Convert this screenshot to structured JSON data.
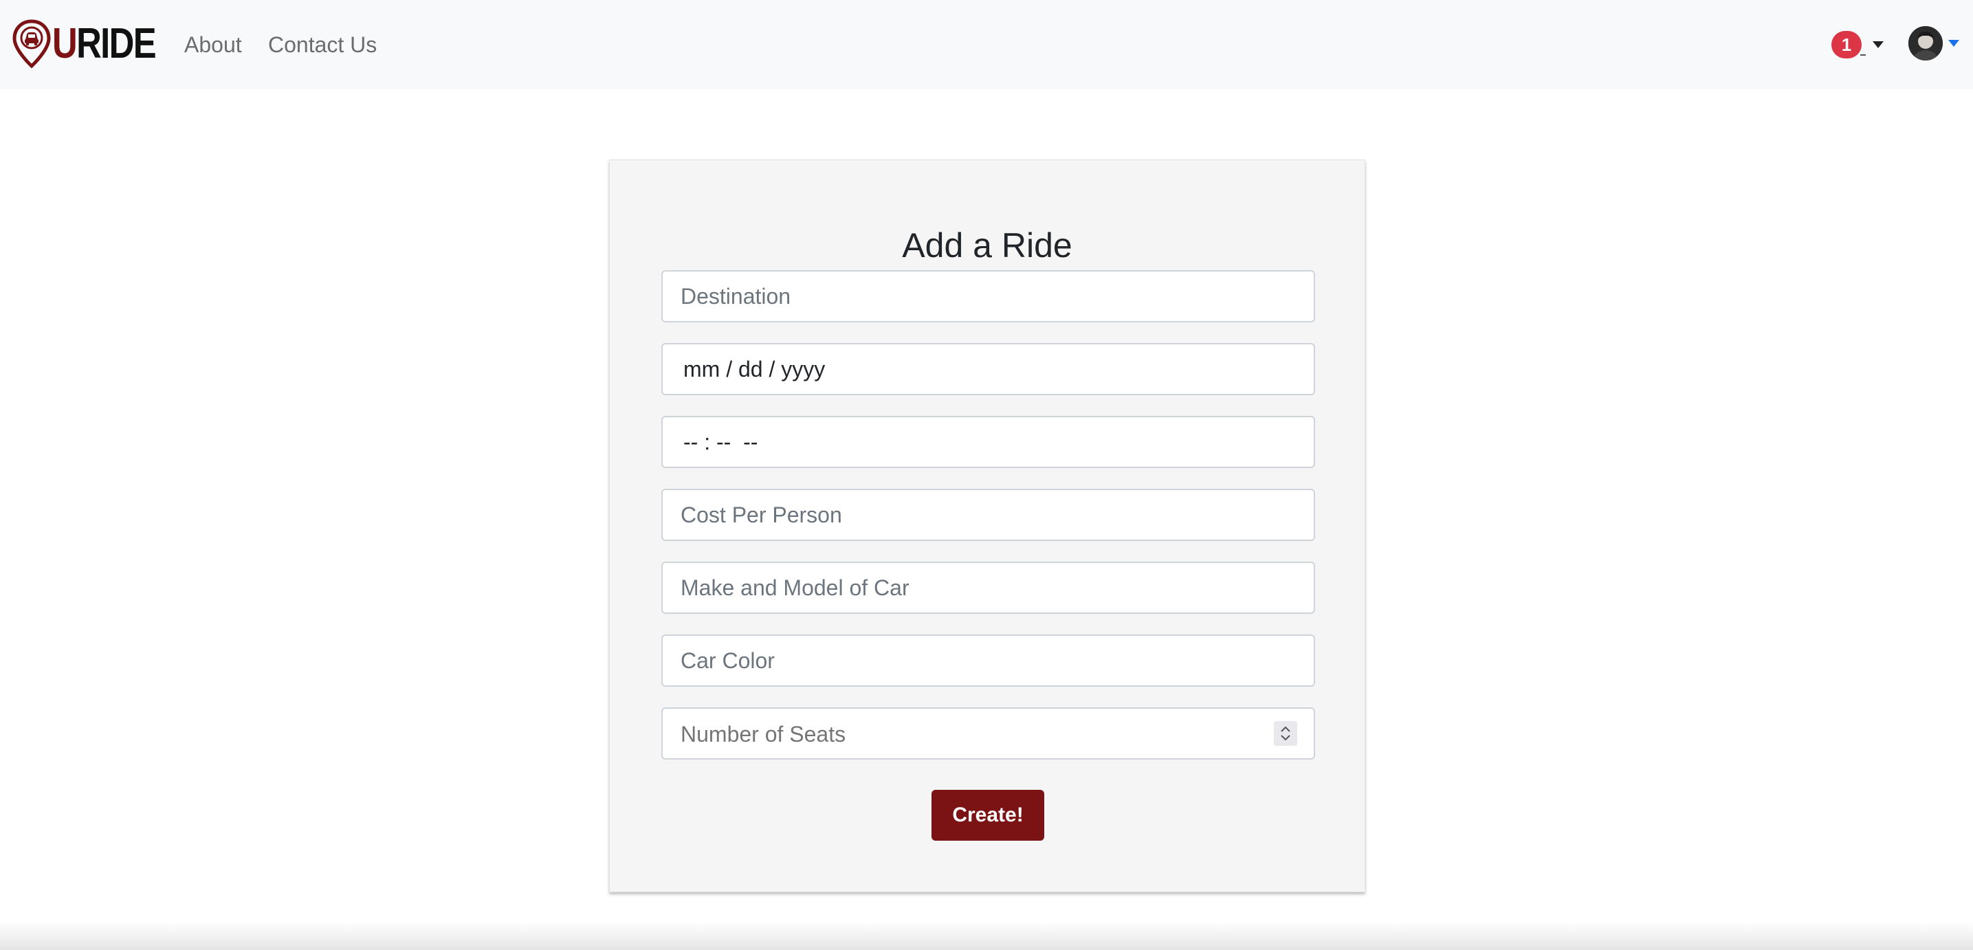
{
  "brand": {
    "name": "URIDE",
    "first_letter": "U",
    "rest": "RIDE",
    "accent_color": "#7b1314",
    "icon": "map-pin-car-icon"
  },
  "nav": {
    "links": [
      {
        "label": "About"
      },
      {
        "label": "Contact Us"
      }
    ]
  },
  "notifications": {
    "count": "1",
    "badge_color": "#dc3545",
    "icon": "caret-down-icon"
  },
  "user_menu": {
    "avatar_icon": "user-avatar",
    "caret_icon": "caret-down-icon"
  },
  "form": {
    "title": "Add a Ride",
    "fields": {
      "destination": {
        "placeholder": "Destination"
      },
      "date": {
        "mask": "mm / dd / yyyy"
      },
      "time": {
        "mask": "-- : --  --"
      },
      "cost": {
        "placeholder": "Cost Per Person"
      },
      "car_model": {
        "placeholder": "Make and Model of Car"
      },
      "car_color": {
        "placeholder": "Car Color"
      },
      "seats": {
        "placeholder": "Number of Seats"
      }
    },
    "submit_label": "Create!",
    "submit_color": "#7b1314"
  }
}
